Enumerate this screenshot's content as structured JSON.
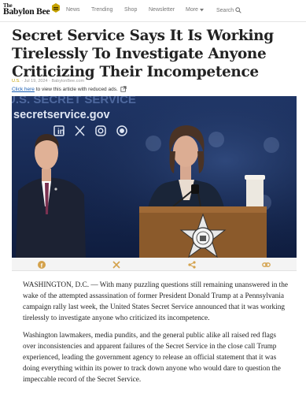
{
  "header": {
    "logo_the": "The",
    "logo_name": "Babylon Bee",
    "nav": [
      "News",
      "Trending",
      "Shop",
      "Newsletter",
      "More",
      "Search"
    ]
  },
  "article": {
    "title": "Secret Service Says It Is Working Tirelessly To Investigate Anyone Criticizing Their Incompetence",
    "category": "U.S.",
    "meta_rest": " · Jul 19, 2024 · BabylonBee.com",
    "reduced_ads_link": "Click here",
    "reduced_ads_rest": " to view this article with reduced ads.",
    "photo_banner_text": "secretservice.gov",
    "photo_top_text": "U.S. SECRET SERVICE",
    "paragraphs": [
      "WASHINGTON, D.C. — With many puzzling questions still remaining unanswered in the wake of the attempted assassination of former President Donald Trump at a Pennsylvania campaign rally last week, the United States Secret Service announced that it was working tirelessly to investigate anyone who criticized its incompetence.",
      "Washington lawmakers, media pundits, and the general public alike all raised red flags over inconsistencies and apparent failures of the Secret Service in the close call Trump experienced, leading the government agency to release an official statement that it was doing everything within its power to track down anyone who would dare to question the impeccable record of the Secret Service."
    ]
  },
  "colors": {
    "accent": "#c7a300",
    "link": "#1a5fb4",
    "photo_bg": "#16284f"
  },
  "share_icons": [
    "facebook-icon",
    "x-icon",
    "share-icon",
    "link-icon"
  ]
}
